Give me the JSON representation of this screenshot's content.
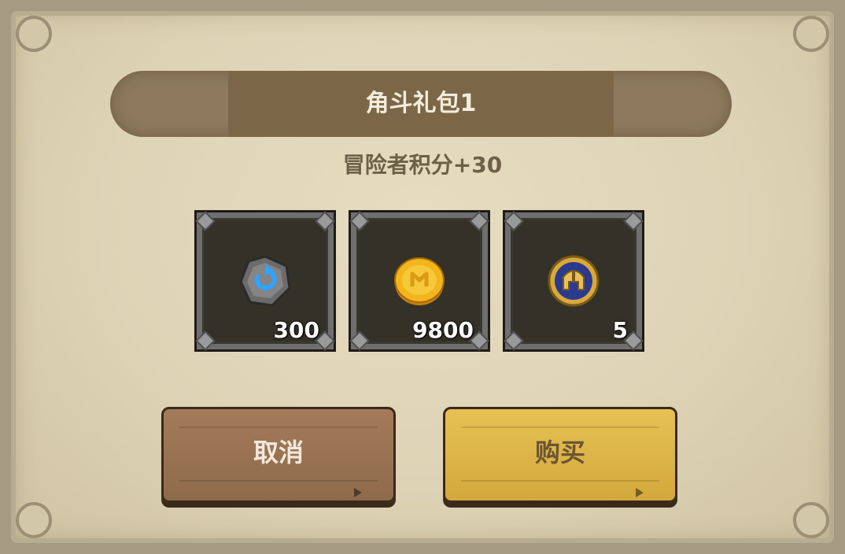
{
  "dialog": {
    "title": "角斗礼包1",
    "subtitle": "冒险者积分+30"
  },
  "items": [
    {
      "icon": "gray-rune-stone-icon",
      "count": "300"
    },
    {
      "icon": "gold-coin-icon",
      "count": "9800"
    },
    {
      "icon": "gladiator-helmet-medal-icon",
      "count": "5"
    }
  ],
  "buttons": {
    "cancel_label": "取消",
    "buy_label": "购买"
  },
  "colors": {
    "cancel": "#a37b5a",
    "buy": "#e6c153",
    "slot_bg": "#333128",
    "banner": "#7b6748"
  }
}
